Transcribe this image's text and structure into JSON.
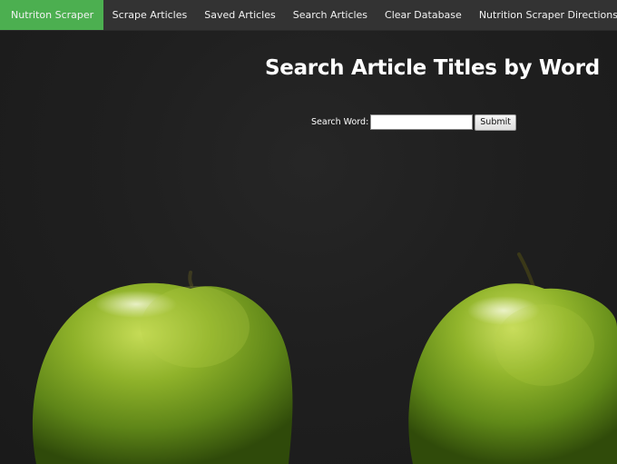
{
  "navbar": {
    "items": [
      {
        "label": "Nutriton Scraper",
        "active": true
      },
      {
        "label": "Scrape Articles"
      },
      {
        "label": "Saved Articles"
      },
      {
        "label": "Search Articles"
      },
      {
        "label": "Clear Database"
      },
      {
        "label": "Nutrition Scraper Directions"
      }
    ],
    "active_color": "#4CAF50",
    "background_color": "#333333"
  },
  "main": {
    "title": "Search Article Titles by Word",
    "search": {
      "label": "Search Word:",
      "value": "",
      "submit_label": "Submit"
    }
  },
  "background": {
    "image_subject": "two-green-apples",
    "color": "#1c1c1c"
  }
}
